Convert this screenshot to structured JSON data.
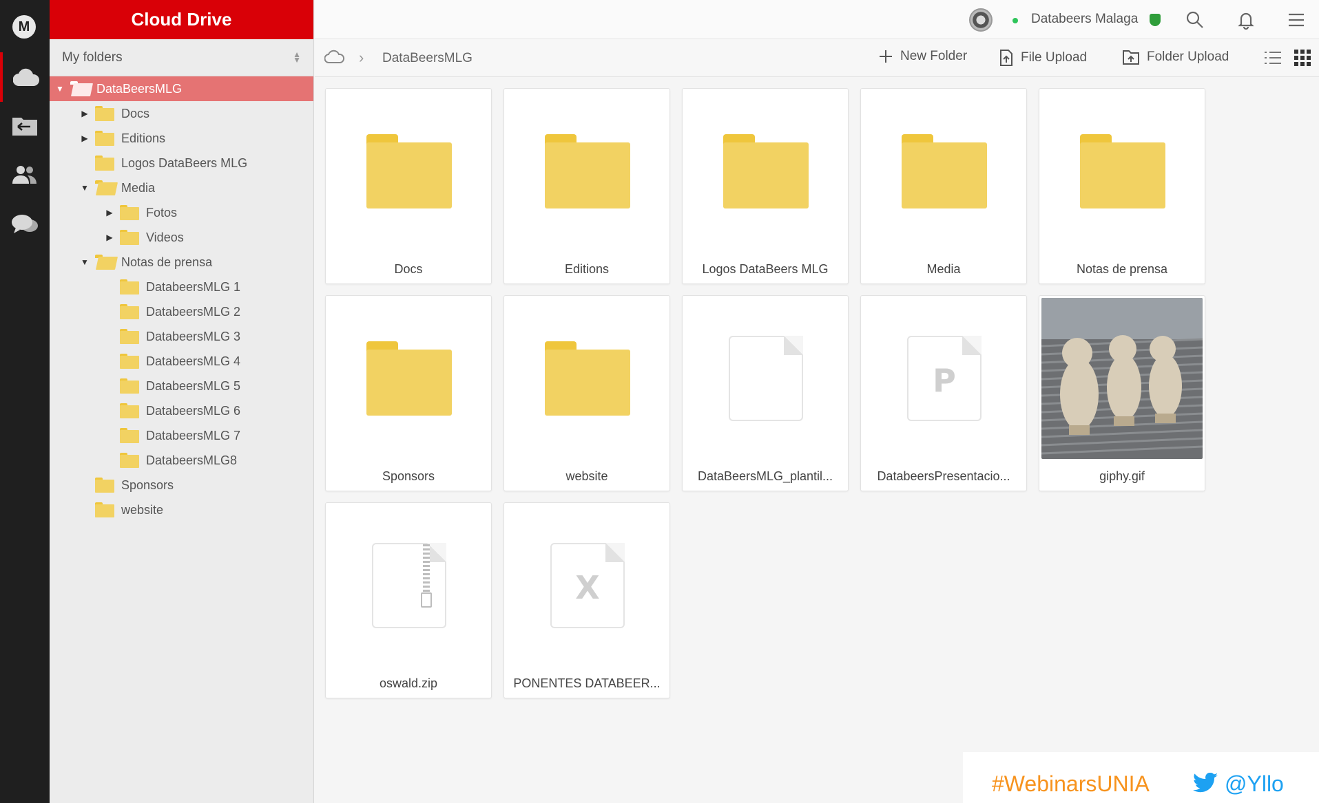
{
  "app": {
    "brand": "Cloud Drive"
  },
  "tree": {
    "header": "My folders",
    "nodes": [
      {
        "label": "DataBeersMLG",
        "depth": 0,
        "caret": "▼",
        "selected": true,
        "open": true
      },
      {
        "label": "Docs",
        "depth": 1,
        "caret": "▶"
      },
      {
        "label": "Editions",
        "depth": 1,
        "caret": "▶"
      },
      {
        "label": "Logos DataBeers MLG",
        "depth": 1,
        "caret": ""
      },
      {
        "label": "Media",
        "depth": 1,
        "caret": "▼",
        "open": true
      },
      {
        "label": "Fotos",
        "depth": 2,
        "caret": "▶"
      },
      {
        "label": "Videos",
        "depth": 2,
        "caret": "▶"
      },
      {
        "label": "Notas de prensa",
        "depth": 1,
        "caret": "▼",
        "open": true
      },
      {
        "label": "DatabeersMLG 1",
        "depth": 2,
        "caret": ""
      },
      {
        "label": "DatabeersMLG 2",
        "depth": 2,
        "caret": ""
      },
      {
        "label": "DatabeersMLG 3",
        "depth": 2,
        "caret": ""
      },
      {
        "label": "DatabeersMLG 4",
        "depth": 2,
        "caret": ""
      },
      {
        "label": "DatabeersMLG 5",
        "depth": 2,
        "caret": ""
      },
      {
        "label": "DatabeersMLG 6",
        "depth": 2,
        "caret": ""
      },
      {
        "label": "DatabeersMLG 7",
        "depth": 2,
        "caret": ""
      },
      {
        "label": "DatabeersMLG8",
        "depth": 2,
        "caret": ""
      },
      {
        "label": "Sponsors",
        "depth": 1,
        "caret": ""
      },
      {
        "label": "website",
        "depth": 1,
        "caret": ""
      }
    ]
  },
  "topbar": {
    "username": "Databeers Malaga"
  },
  "toolbar": {
    "breadcrumb": "DataBeersMLG",
    "new_folder": "New Folder",
    "file_upload": "File Upload",
    "folder_upload": "Folder Upload"
  },
  "items": [
    {
      "name": "Docs",
      "kind": "folder"
    },
    {
      "name": "Editions",
      "kind": "folder"
    },
    {
      "name": "Logos DataBeers MLG",
      "kind": "folder"
    },
    {
      "name": "Media",
      "kind": "folder"
    },
    {
      "name": "Notas de prensa",
      "kind": "folder"
    },
    {
      "name": "Sponsors",
      "kind": "folder"
    },
    {
      "name": "website",
      "kind": "folder"
    },
    {
      "name": "DataBeersMLG_plantil...",
      "kind": "doc",
      "letter": ""
    },
    {
      "name": "DatabeersPresentacio...",
      "kind": "doc",
      "letter": "P"
    },
    {
      "name": "giphy.gif",
      "kind": "image"
    },
    {
      "name": "oswald.zip",
      "kind": "zip"
    },
    {
      "name": "PONENTES DATABEER...",
      "kind": "doc",
      "letter": "X"
    }
  ],
  "footer": {
    "hashtag": "#WebinarsUNIA",
    "handle": "@Yllo"
  },
  "colors": {
    "brand_red": "#d90007",
    "folder_yellow": "#f2d262",
    "selected_row": "#e57373",
    "hashtag_orange": "#f7931e",
    "twitter_blue": "#1da1f2"
  }
}
